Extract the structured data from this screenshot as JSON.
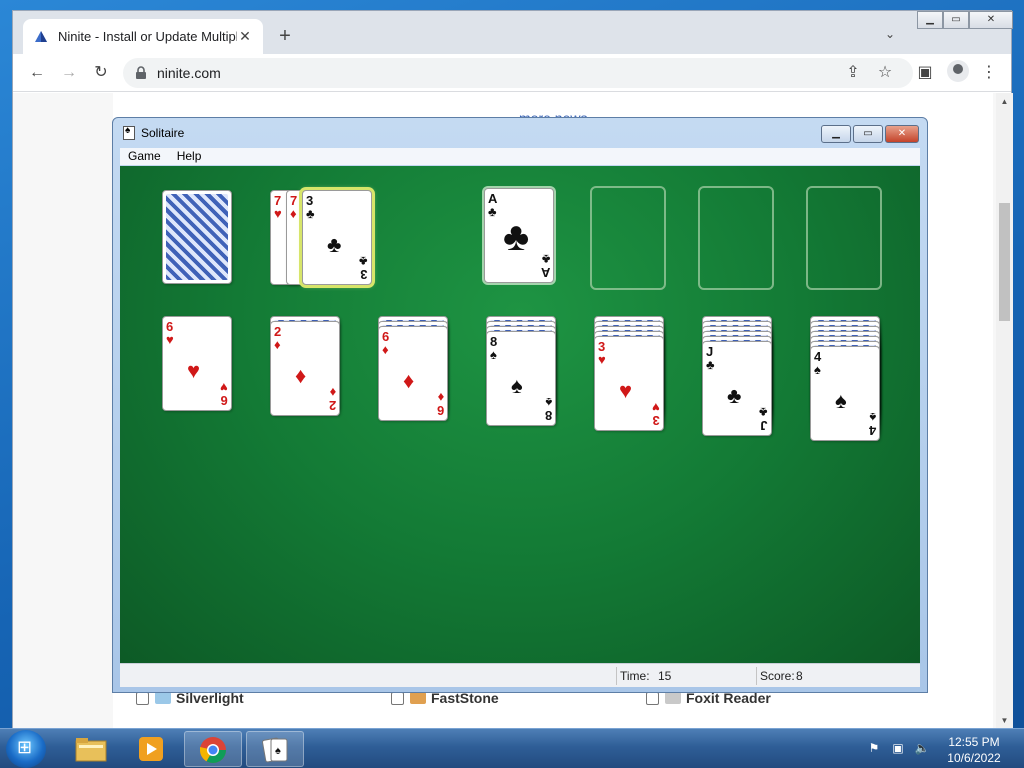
{
  "browser": {
    "tab_title": "Ninite - Install or Update Multiple Apps at Once",
    "tab_close": "✕",
    "new_tab": "+",
    "url": "ninite.com",
    "back": "←",
    "forward": "→",
    "reload": "↻",
    "share": "⇪",
    "bookmark": "☆",
    "sidepanel": "▣",
    "menu": "⋮",
    "tabsearch": "⌄",
    "minimize": "▁",
    "maximize": "▭",
    "close": "✕"
  },
  "page": {
    "more_news": "more news",
    "apps": [
      {
        "label": "Silverlight",
        "icon_color": "#9bc8e8"
      },
      {
        "label": "FastStone",
        "icon_color": "#e0a050"
      },
      {
        "label": "Foxit Reader",
        "icon_color": "#c9c9c9"
      }
    ]
  },
  "solitaire": {
    "title": "Solitaire",
    "menu": [
      "Game",
      "Help"
    ],
    "time_label": "Time:",
    "time_value": "15",
    "score_label": "Score:",
    "score_value": "8",
    "waste": [
      {
        "rank": "7",
        "suit": "♥",
        "color": "red"
      },
      {
        "rank": "7",
        "suit": "♦",
        "color": "red"
      },
      {
        "rank": "3",
        "suit": "♣",
        "color": "black"
      }
    ],
    "foundation": [
      {
        "rank": "A",
        "suit": "♣",
        "color": "black"
      }
    ],
    "tableau": [
      {
        "hidden": 0,
        "rank": "6",
        "suit": "♥",
        "color": "red"
      },
      {
        "hidden": 1,
        "rank": "2",
        "suit": "♦",
        "color": "red"
      },
      {
        "hidden": 2,
        "rank": "6",
        "suit": "♦",
        "color": "red"
      },
      {
        "hidden": 3,
        "rank": "8",
        "suit": "♠",
        "color": "black"
      },
      {
        "hidden": 4,
        "rank": "3",
        "suit": "♥",
        "color": "red"
      },
      {
        "hidden": 5,
        "rank": "J",
        "suit": "♣",
        "color": "black"
      },
      {
        "hidden": 6,
        "rank": "4",
        "suit": "♠",
        "color": "black"
      }
    ]
  },
  "taskbar": {
    "clock_time": "12:55 PM",
    "clock_date": "10/6/2022",
    "items": [
      "windows-explorer",
      "media-player",
      "chrome",
      "solitaire"
    ]
  },
  "colors": {
    "felt": "#137a35",
    "card_red": "#d01818",
    "link": "#3a64b5",
    "taskbar": "#2f5e97"
  }
}
